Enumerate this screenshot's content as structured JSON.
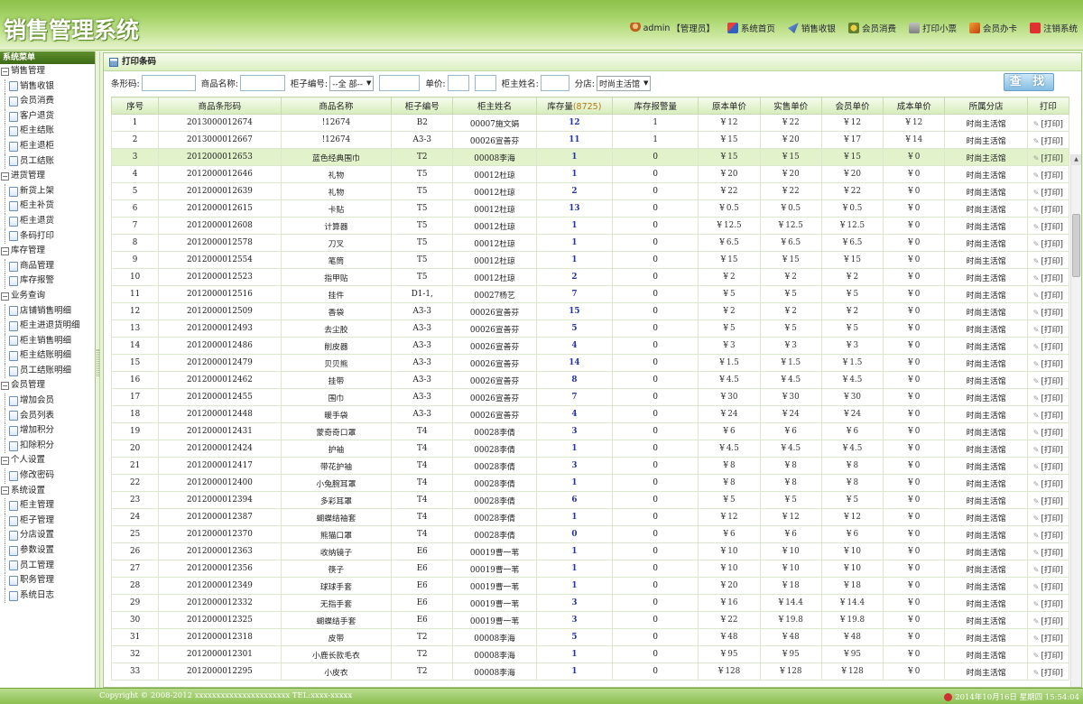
{
  "app": {
    "title": "销售管理系统"
  },
  "topnav": [
    {
      "label": "admin",
      "icon": "user-icon"
    },
    {
      "label": "【管理员】",
      "icon": "none"
    },
    {
      "label": "系统首页",
      "icon": "home-icon"
    },
    {
      "label": "销售收银",
      "icon": "cashier-icon"
    },
    {
      "label": "会员消费",
      "icon": "member-icon"
    },
    {
      "label": "打印小票",
      "icon": "print-icon"
    },
    {
      "label": "会员办卡",
      "icon": "card-icon"
    },
    {
      "label": "注销系统",
      "icon": "logout-icon"
    }
  ],
  "sidebar": {
    "title": "系统菜单",
    "groups": [
      {
        "label": "销售管理",
        "items": [
          "销售收银",
          "会员消费",
          "客户退货",
          "柜主结账",
          "柜主退柜",
          "员工结账"
        ]
      },
      {
        "label": "进货管理",
        "items": [
          "新货上架",
          "柜主补货",
          "柜主退货",
          "条码打印"
        ]
      },
      {
        "label": "库存管理",
        "items": [
          "商品管理",
          "库存报警"
        ]
      },
      {
        "label": "业务查询",
        "items": [
          "店铺销售明细",
          "柜主进退货明细",
          "柜主销售明细",
          "柜主结账明细",
          "员工结账明细"
        ]
      },
      {
        "label": "会员管理",
        "items": [
          "增加会员",
          "会员列表",
          "增加积分",
          "扣除积分"
        ]
      },
      {
        "label": "个人设置",
        "items": [
          "修改密码"
        ]
      },
      {
        "label": "系统设置",
        "items": [
          "柜主管理",
          "柜子管理",
          "分店设置",
          "参数设置",
          "员工管理",
          "职务管理",
          "系统日志"
        ]
      }
    ]
  },
  "panel": {
    "title": "打印条码"
  },
  "search": {
    "barcode_label": "条形码:",
    "name_label": "商品名称:",
    "cabinet_label": "柜子编号:",
    "cabinet_select": "--全 部--",
    "price_label": "单价:",
    "owner_label": "柜主姓名:",
    "branch_label": "分店:",
    "branch_select": "时尚主活馆",
    "button": "查 找"
  },
  "table": {
    "headers": [
      "序号",
      "商品条形码",
      "商品名称",
      "柜子编号",
      "柜主姓名",
      "库存量",
      "库存报警量",
      "原本单价",
      "实售单价",
      "会员单价",
      "成本单价",
      "所属分店",
      "打印"
    ],
    "stock_total": "(8725)",
    "print_label": "[打印]",
    "rows": [
      [
        "1",
        "2013000012674",
        "!12674",
        "B2",
        "00007施文娟",
        "12",
        "1",
        "12",
        "22",
        "12",
        "12",
        "时尚主活馆"
      ],
      [
        "2",
        "2013000012667",
        "!12674",
        "A3-3",
        "00026宣善芬",
        "11",
        "1",
        "15",
        "20",
        "17",
        "14",
        "时尚主活馆"
      ],
      [
        "3",
        "2012000012653",
        "蓝色经典围巾",
        "T2",
        "00008李海",
        "1",
        "0",
        "15",
        "15",
        "15",
        "0",
        "时尚主活馆"
      ],
      [
        "4",
        "2012000012646",
        "礼物",
        "T5",
        "00012杜琼",
        "1",
        "0",
        "20",
        "20",
        "20",
        "0",
        "时尚主活馆"
      ],
      [
        "5",
        "2012000012639",
        "礼物",
        "T5",
        "00012杜琼",
        "2",
        "0",
        "22",
        "22",
        "22",
        "0",
        "时尚主活馆"
      ],
      [
        "6",
        "2012000012615",
        "卡贴",
        "T5",
        "00012杜琼",
        "13",
        "0",
        "0.5",
        "0.5",
        "0.5",
        "0",
        "时尚主活馆"
      ],
      [
        "7",
        "2012000012608",
        "计算器",
        "T5",
        "00012杜琼",
        "1",
        "0",
        "12.5",
        "12.5",
        "12.5",
        "0",
        "时尚主活馆"
      ],
      [
        "8",
        "2012000012578",
        "刀叉",
        "T5",
        "00012杜琼",
        "1",
        "0",
        "6.5",
        "6.5",
        "6.5",
        "0",
        "时尚主活馆"
      ],
      [
        "9",
        "2012000012554",
        "笔筒",
        "T5",
        "00012杜琼",
        "1",
        "0",
        "15",
        "15",
        "15",
        "0",
        "时尚主活馆"
      ],
      [
        "10",
        "2012000012523",
        "指甲贴",
        "T5",
        "00012杜琼",
        "2",
        "0",
        "2",
        "2",
        "2",
        "0",
        "时尚主活馆"
      ],
      [
        "11",
        "2012000012516",
        "挂件",
        "D1-1,",
        "00027杨艺",
        "7",
        "0",
        "5",
        "5",
        "5",
        "0",
        "时尚主活馆"
      ],
      [
        "12",
        "2012000012509",
        "香袋",
        "A3-3",
        "00026宣善芬",
        "15",
        "0",
        "2",
        "2",
        "2",
        "0",
        "时尚主活馆"
      ],
      [
        "13",
        "2012000012493",
        "去尘胶",
        "A3-3",
        "00026宣善芬",
        "5",
        "0",
        "5",
        "5",
        "5",
        "0",
        "时尚主活馆"
      ],
      [
        "14",
        "2012000012486",
        "削皮器",
        "A3-3",
        "00026宣善芬",
        "4",
        "0",
        "3",
        "3",
        "3",
        "0",
        "时尚主活馆"
      ],
      [
        "15",
        "2012000012479",
        "贝贝熊",
        "A3-3",
        "00026宣善芬",
        "14",
        "0",
        "1.5",
        "1.5",
        "1.5",
        "0",
        "时尚主活馆"
      ],
      [
        "16",
        "2012000012462",
        "挂带",
        "A3-3",
        "00026宣善芬",
        "8",
        "0",
        "4.5",
        "4.5",
        "4.5",
        "0",
        "时尚主活馆"
      ],
      [
        "17",
        "2012000012455",
        "围巾",
        "A3-3",
        "00026宣善芬",
        "7",
        "0",
        "30",
        "30",
        "30",
        "0",
        "时尚主活馆"
      ],
      [
        "18",
        "2012000012448",
        "暖手袋",
        "A3-3",
        "00026宣善芬",
        "4",
        "0",
        "24",
        "24",
        "24",
        "0",
        "时尚主活馆"
      ],
      [
        "19",
        "2012000012431",
        "蒙奇奇口罩",
        "T4",
        "00028李倩",
        "3",
        "0",
        "6",
        "6",
        "6",
        "0",
        "时尚主活馆"
      ],
      [
        "20",
        "2012000012424",
        "护袖",
        "T4",
        "00028李倩",
        "1",
        "0",
        "4.5",
        "4.5",
        "4.5",
        "0",
        "时尚主活馆"
      ],
      [
        "21",
        "2012000012417",
        "带花护袖",
        "T4",
        "00028李倩",
        "3",
        "0",
        "8",
        "8",
        "8",
        "0",
        "时尚主活馆"
      ],
      [
        "22",
        "2012000012400",
        "小兔腕耳罩",
        "T4",
        "00028李倩",
        "1",
        "0",
        "8",
        "8",
        "8",
        "0",
        "时尚主活馆"
      ],
      [
        "23",
        "2012000012394",
        "多彩耳罩",
        "T4",
        "00028李倩",
        "6",
        "0",
        "5",
        "5",
        "5",
        "0",
        "时尚主活馆"
      ],
      [
        "24",
        "2012000012387",
        "蝴蝶结袖套",
        "T4",
        "00028李倩",
        "1",
        "0",
        "12",
        "12",
        "12",
        "0",
        "时尚主活馆"
      ],
      [
        "25",
        "2012000012370",
        "熊猫口罩",
        "T4",
        "00028李倩",
        "0",
        "0",
        "6",
        "6",
        "6",
        "0",
        "时尚主活馆"
      ],
      [
        "26",
        "2012000012363",
        "收纳镜子",
        "E6",
        "00019曹一苇",
        "1",
        "0",
        "10",
        "10",
        "10",
        "0",
        "时尚主活馆"
      ],
      [
        "27",
        "2012000012356",
        "筷子",
        "E6",
        "00019曹一苇",
        "1",
        "0",
        "10",
        "10",
        "10",
        "0",
        "时尚主活馆"
      ],
      [
        "28",
        "2012000012349",
        "球球手套",
        "E6",
        "00019曹一苇",
        "1",
        "0",
        "20",
        "18",
        "18",
        "0",
        "时尚主活馆"
      ],
      [
        "29",
        "2012000012332",
        "无指手套",
        "E6",
        "00019曹一苇",
        "3",
        "0",
        "16",
        "14.4",
        "14.4",
        "0",
        "时尚主活馆"
      ],
      [
        "30",
        "2012000012325",
        "蝴蝶结手套",
        "E6",
        "00019曹一苇",
        "3",
        "0",
        "22",
        "19.8",
        "19.8",
        "0",
        "时尚主活馆"
      ],
      [
        "31",
        "2012000012318",
        "皮带",
        "T2",
        "00008李海",
        "5",
        "0",
        "48",
        "48",
        "48",
        "0",
        "时尚主活馆"
      ],
      [
        "32",
        "2012000012301",
        "小鹿长款毛衣",
        "T2",
        "00008李海",
        "1",
        "0",
        "95",
        "95",
        "95",
        "0",
        "时尚主活馆"
      ],
      [
        "33",
        "2012000012295",
        "小皮衣",
        "T2",
        "00008李海",
        "1",
        "0",
        "128",
        "128",
        "128",
        "0",
        "时尚主活馆"
      ]
    ]
  },
  "footer": {
    "copyright": "Copyright © 2008-2012 xxxxxxxxxxxxxxxxxxxxxx TEL:xxxx-xxxxx",
    "datetime": "2014年10月16日 星期四 15:54:04"
  },
  "colors": {
    "accent_green": "#8cc04a",
    "highlight_row": "#e2f3cb",
    "stock_blue": "#2233aa"
  }
}
